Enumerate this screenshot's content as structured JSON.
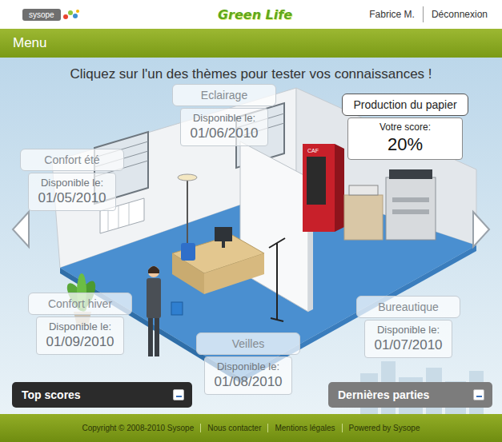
{
  "header": {
    "logo": "sysope",
    "brand": "Green Life",
    "user": "Fabrice M.",
    "logout": "Déconnexion"
  },
  "menu_bar": {
    "title": "Menu"
  },
  "prompt": "Cliquez sur l'un des thèmes pour tester vos connaissances !",
  "themes": [
    {
      "title": "Eclairage",
      "locked": true,
      "label": "Disponible le:",
      "value": "01/06/2010"
    },
    {
      "title": "Confort été",
      "locked": true,
      "label": "Disponible le:",
      "value": "01/05/2010"
    },
    {
      "title": "Production du papier",
      "locked": false,
      "label": "Votre score:",
      "value": "20%"
    },
    {
      "title": "Confort hiver",
      "locked": true,
      "label": "Disponible le:",
      "value": "01/09/2010"
    },
    {
      "title": "Veilles",
      "locked": true,
      "label": "Disponible le:",
      "value": "01/08/2010"
    },
    {
      "title": "Bureautique",
      "locked": true,
      "label": "Disponible le:",
      "value": "01/07/2010"
    }
  ],
  "illustration": {
    "machine_label": "CAF"
  },
  "panels": [
    {
      "title": "Top scores",
      "expanded": false,
      "color": "#2b2b2b"
    },
    {
      "title": "Dernières parties",
      "expanded": false,
      "color": "#7c7c7c"
    }
  ],
  "footer": {
    "links": [
      "Copyright © 2008-2010 Sysope",
      "Nous contacter",
      "Mentions légales",
      "Powered by Sysope"
    ]
  }
}
